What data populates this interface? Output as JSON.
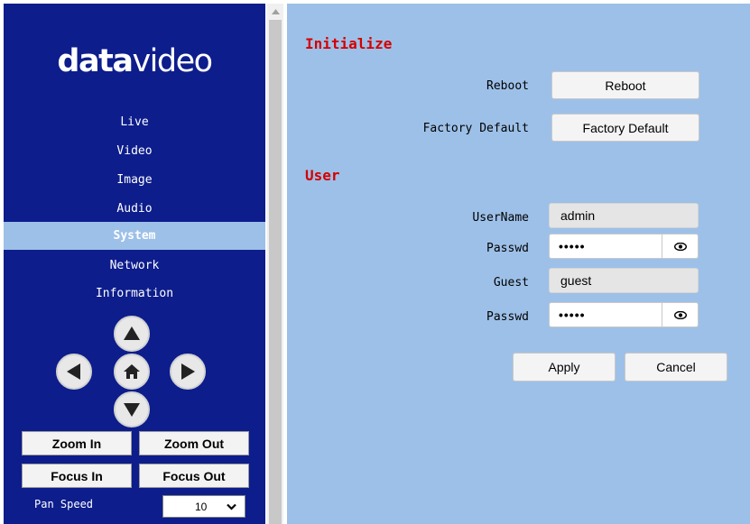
{
  "logo": {
    "part1": "data",
    "part2": "video"
  },
  "nav": {
    "items": [
      {
        "label": "Live",
        "active": false
      },
      {
        "label": "Video",
        "active": false
      },
      {
        "label": "Image",
        "active": false
      },
      {
        "label": "Audio",
        "active": false
      },
      {
        "label": "System",
        "active": true
      },
      {
        "label": "Network",
        "active": false
      },
      {
        "label": "Information",
        "active": false
      }
    ]
  },
  "ptz": {
    "icons": [
      "arrow-up-icon",
      "arrow-left-icon",
      "home-icon",
      "arrow-right-icon",
      "arrow-down-icon"
    ]
  },
  "controls": {
    "zoom_in": "Zoom In",
    "zoom_out": "Zoom Out",
    "focus_in": "Focus In",
    "focus_out": "Focus Out",
    "pan_speed_label": "Pan Speed",
    "pan_speed_value": "10"
  },
  "initialize": {
    "title": "Initialize",
    "reboot_label": "Reboot",
    "reboot_button": "Reboot",
    "factory_label": "Factory Default",
    "factory_button": "Factory Default"
  },
  "user": {
    "title": "User",
    "username_label": "UserName",
    "username_value": "admin",
    "passwd_label": "Passwd",
    "passwd_value": "•••••",
    "guest_label": "Guest",
    "guest_value": "guest",
    "guest_passwd_label": "Passwd",
    "guest_passwd_value": "•••••"
  },
  "actions": {
    "apply": "Apply",
    "cancel": "Cancel"
  },
  "colors": {
    "sidebar_bg": "#0d1d8c",
    "active_nav_bg": "#9dc0e8",
    "main_bg": "#9dc0e8",
    "section_title": "#d40000"
  },
  "chart_data": null
}
